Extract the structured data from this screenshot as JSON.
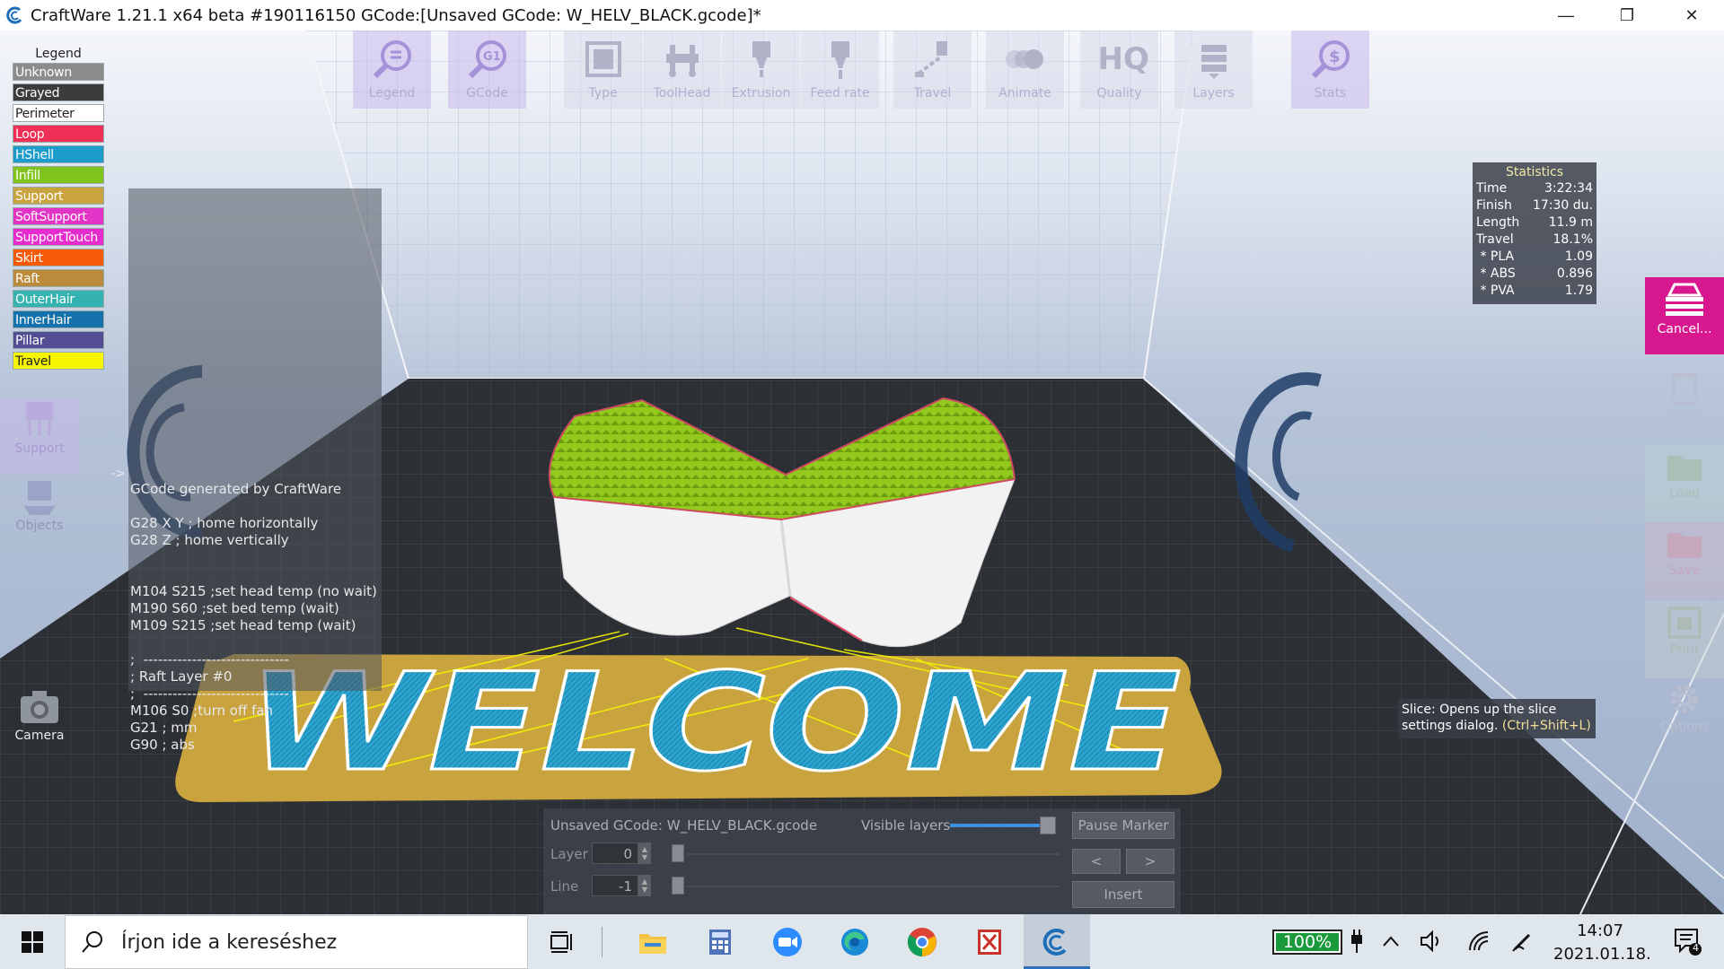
{
  "window": {
    "title": "CraftWare 1.21.1 x64 beta #190116150   GCode:[Unsaved GCode: W_HELV_BLACK.gcode]*",
    "minimize": "—",
    "restore": "❐",
    "close": "✕"
  },
  "toolbar": [
    {
      "label": "Legend",
      "icon": "legend-magnifier-icon"
    },
    {
      "label": "GCode",
      "icon": "gcode-magnifier-icon"
    },
    {
      "label": "Type",
      "icon": "type-icon"
    },
    {
      "label": "ToolHead",
      "icon": "toolhead-icon"
    },
    {
      "label": "Extrusion",
      "icon": "extrusion-icon"
    },
    {
      "label": "Feed rate",
      "icon": "feed-rate-icon"
    },
    {
      "label": "Travel",
      "icon": "travel-icon"
    },
    {
      "label": "Animate",
      "icon": "animate-icon"
    },
    {
      "label": "Quality",
      "icon": "quality-hq-icon",
      "glyph": "HQ"
    },
    {
      "label": "Layers",
      "icon": "layers-icon"
    },
    {
      "label": "Stats",
      "icon": "stats-icon"
    }
  ],
  "legend": {
    "title": "Legend",
    "items": [
      {
        "label": "Unknown",
        "color": "#8c8c8c",
        "text": "#ffffff"
      },
      {
        "label": "Grayed",
        "color": "#3c3c3c",
        "text": "#ffffff"
      },
      {
        "label": "Perimeter",
        "color": "#ffffff",
        "text": "#222222"
      },
      {
        "label": "Loop",
        "color": "#ef2f55",
        "text": "#ffffff"
      },
      {
        "label": "HShell",
        "color": "#1d9ccc",
        "text": "#ffffff"
      },
      {
        "label": "Infill",
        "color": "#7fc31c",
        "text": "#ffffff"
      },
      {
        "label": "Support",
        "color": "#c9a33e",
        "text": "#ffffff"
      },
      {
        "label": "SoftSupport",
        "color": "#e234c7",
        "text": "#ffffff"
      },
      {
        "label": "SupportTouch",
        "color": "#e62ccf",
        "text": "#ffffff"
      },
      {
        "label": "Skirt",
        "color": "#f45a08",
        "text": "#ffffff"
      },
      {
        "label": "Raft",
        "color": "#bb8b3b",
        "text": "#ffffff"
      },
      {
        "label": "OuterHair",
        "color": "#35b3b0",
        "text": "#ffffff"
      },
      {
        "label": "InnerHair",
        "color": "#1672ab",
        "text": "#ffffff"
      },
      {
        "label": "Pillar",
        "color": "#534d93",
        "text": "#ffffff"
      },
      {
        "label": "Travel",
        "color": "#f6f600",
        "text": "#222222"
      }
    ]
  },
  "gcode_panel": {
    "arrow": "->",
    "lines": [
      "GCode generated by CraftWare",
      "",
      "G28 X Y ; home horizontally",
      "G28 Z ; home vertically",
      "",
      "",
      "M104 S215 ;set head temp (no wait)",
      "M190 S60 ;set bed temp (wait)",
      "M109 S215 ;set head temp (wait)",
      "",
      ";  ------------------------------",
      "; Raft Layer #0",
      ";  ------------------------------",
      "M106 S0 ;turn off fan",
      "G21 ; mm",
      "G90 ; abs"
    ]
  },
  "left_buttons": [
    {
      "label": "Support",
      "icon": "support-icon"
    },
    {
      "label": "Objects",
      "icon": "objects-icon"
    },
    {
      "label": "Camera",
      "icon": "camera-icon"
    }
  ],
  "stats": {
    "title": "Statistics",
    "rows": [
      {
        "k": "Time",
        "v": "3:22:34"
      },
      {
        "k": "Finish",
        "v": "17:30 du."
      },
      {
        "k": "Length",
        "v": "11.9 m"
      },
      {
        "k": "Travel",
        "v": "18.1%"
      },
      {
        "k": " * PLA",
        "v": "1.09"
      },
      {
        "k": " * ABS",
        "v": "0.896"
      },
      {
        "k": " * PVA",
        "v": "1.79"
      }
    ]
  },
  "right_buttons": [
    {
      "label": "Cancel...",
      "icon": "cancel-slice-icon",
      "active": true
    },
    {
      "label": "Clear",
      "icon": "clear-icon"
    },
    {
      "label": "Load",
      "icon": "load-icon"
    },
    {
      "label": "Save",
      "icon": "save-icon"
    },
    {
      "label": "Print",
      "icon": "print-icon"
    },
    {
      "label": "Options",
      "icon": "options-gear-icon"
    }
  ],
  "tooltip": {
    "line1": "Slice: Opens up the slice",
    "line2_prefix": "settings dialog. ",
    "shortcut": "(Ctrl+Shift+L)"
  },
  "model": {
    "text": "WELCOME",
    "colors": {
      "infill": "#9cd11e",
      "hshell": "#1d9ccc",
      "raft": "#c9a33e",
      "perimeter": "#ffffff",
      "travel": "#f6f600"
    }
  },
  "bottom_panel": {
    "filename": "Unsaved GCode: W_HELV_BLACK.gcode",
    "visible_layers_label": "Visible layers",
    "pause_marker": "Pause Marker",
    "layer_label": "Layer",
    "layer_value": "0",
    "line_label": "Line",
    "line_value": "-1",
    "prev": "<",
    "next": ">",
    "insert": "Insert"
  },
  "taskbar": {
    "search_placeholder": "Írjon ide a kereséshez",
    "apps": [
      "task-view-icon",
      "file-explorer-icon",
      "calculator-icon",
      "zoom-icon",
      "edge-icon",
      "chrome-icon",
      "pdf-app-icon",
      "craftware-icon"
    ],
    "battery": "100%",
    "time": "14:07",
    "date": "2021.01.18.",
    "notifications": "4"
  }
}
